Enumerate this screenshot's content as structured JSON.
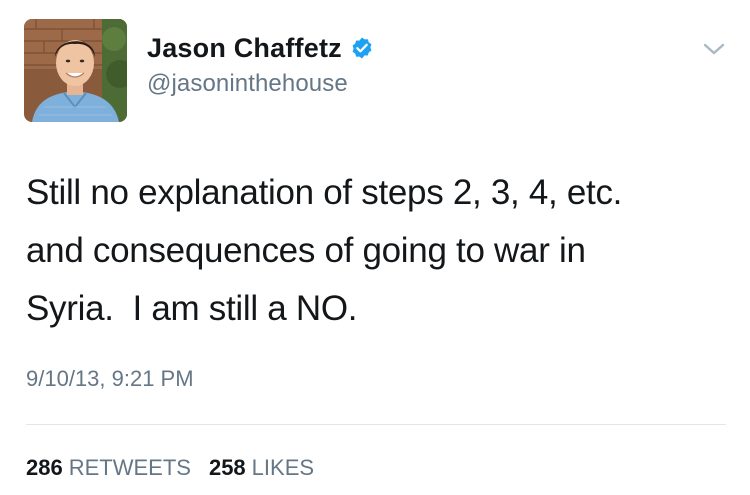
{
  "tweet": {
    "author": {
      "display_name": "Jason Chaffetz",
      "handle": "@jasoninthehouse",
      "verified": true
    },
    "text": "Still no explanation of steps 2, 3, 4, etc.\nand consequences of going to war in\nSyria.  I am still a NO.",
    "timestamp": "9/10/13, 9:21 PM",
    "stats": {
      "retweets_count": "286",
      "retweets_label": "RETWEETS",
      "likes_count": "258",
      "likes_label": "LIKES"
    }
  },
  "icons": {
    "verified": "verified-badge-icon",
    "menu": "chevron-down-icon"
  },
  "colors": {
    "text_primary": "#14171a",
    "text_secondary": "#657786",
    "verified_blue": "#1da1f2",
    "divider": "#e1e8ed",
    "chevron": "#aab8c2"
  }
}
